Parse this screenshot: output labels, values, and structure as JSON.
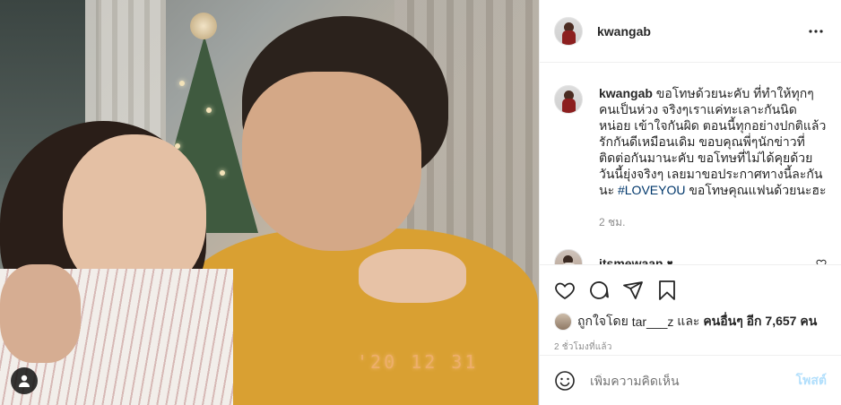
{
  "post": {
    "timestamp_overlay": "'20 12 31"
  },
  "header": {
    "username": "kwangab",
    "more_icon": "more-horizontal-icon"
  },
  "caption": {
    "username": "kwangab",
    "text": "ขอโทษด้วยนะคับ ที่ทำให้ทุกๆคนเป็นห่วง จริงๆเราแค่ทะเลาะกันนิดหน่อย เข้าใจกันผิด ตอนนี้ทุกอย่างปกติแล้ว รักกันดีเหมือนเดิม ขอบคุณพี่ๆนักข่าวที่ติดต่อกันมานะคับ ขอโทษที่ไม่ได้คุยด้วยวันนี้ยุ่งจริงๆ เลยมาขอประกาศทางนี้ละกันนะ",
    "hashtag": "#LOVEYOU",
    "text_after": "ขอโทษคุณแฟนด้วยนะฮะ",
    "time": "2 ชม."
  },
  "comment": {
    "username": "itsmewaan",
    "text": "♥"
  },
  "actions": {
    "like_icon": "heart-icon",
    "comment_icon": "comment-icon",
    "share_icon": "share-icon",
    "save_icon": "bookmark-icon"
  },
  "likes": {
    "prefix": "ถูกใจโดย",
    "user": "tar___z",
    "middle": "และ",
    "others": "คนอื่นๆ อีก 7,657 คน"
  },
  "post_time": "2 ชั่วโมงที่แล้ว",
  "add_comment": {
    "placeholder": "เพิ่มความคิดเห็น",
    "post_label": "โพสต์"
  },
  "colors": {
    "text": "#262626",
    "muted": "#8e8e8e",
    "hashtag": "#00376b",
    "post_disabled": "#b2dffc",
    "border": "#efefef"
  }
}
